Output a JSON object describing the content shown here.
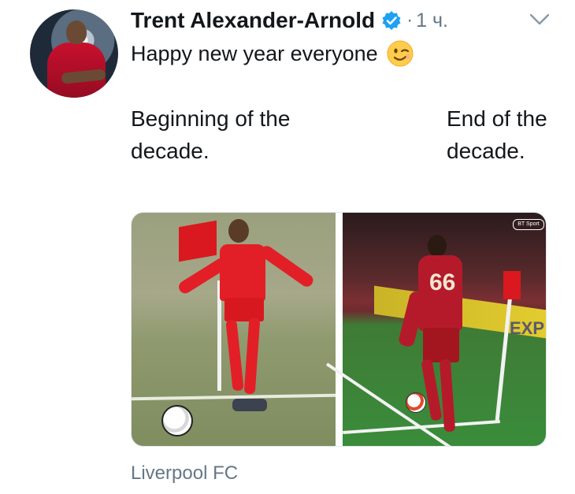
{
  "tweet": {
    "author_name": "Trent Alexander-Arnold",
    "dot": "·",
    "time": "1 ч.",
    "text": "Happy new year everyone",
    "location": "Liverpool FC"
  },
  "captions": {
    "left": "Beginning of the decade.",
    "right": "End of the decade."
  },
  "photos": {
    "right_watermark": "BT Sport",
    "right_shirt_number": "66",
    "right_board_text": "EXP"
  },
  "icons": {
    "verified": "verified-badge-icon",
    "emoji": "winking-face-emoji",
    "chevron": "chevron-down-icon"
  },
  "colors": {
    "accent": "#1da1f2",
    "secondary_text": "#657786",
    "liverpool_red": "#c8102e"
  }
}
